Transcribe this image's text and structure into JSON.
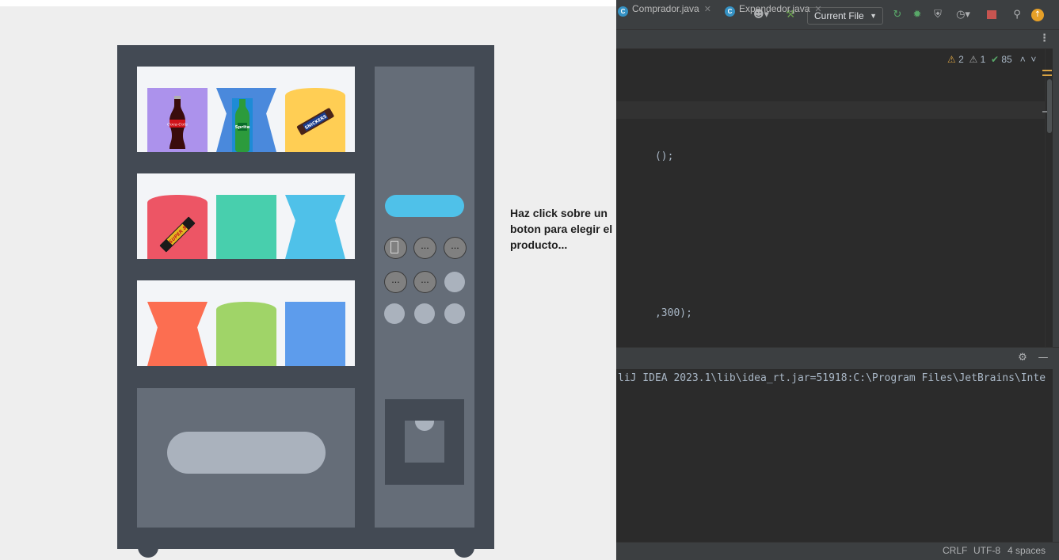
{
  "app": {
    "instruction": "Haz click sobre un boton para elegir el producto...",
    "button_label": "...",
    "products": {
      "coca_cola": "Coca-Cola",
      "sprite": "Sprite",
      "snickers": "SNICKERS",
      "super8": "SUPER 8"
    },
    "colors": {
      "machine_frame": "#434a54",
      "panel": "#656d78",
      "display": "#4fc1e9",
      "shelf_bg": "#f3f5f8",
      "purple": "#ac92ec",
      "blue_cup": "#4a89dc",
      "yellow": "#ffce54",
      "red": "#ed5565",
      "mint": "#48cfad",
      "cyan": "#4fc1e9",
      "orange": "#fc6e51",
      "green": "#a0d468",
      "blue": "#5d9cec"
    }
  },
  "ide": {
    "run_config": "Current File",
    "tabs": [
      {
        "label": "Comprador.java",
        "icon": "java-class-icon"
      },
      {
        "label": "Expendedor.java",
        "icon": "java-class-icon"
      }
    ],
    "inspections": {
      "warnings": "2",
      "weak_warnings": "1",
      "ok": "85"
    },
    "code_fragments": [
      "();",
      ",300);"
    ],
    "run_output": "liJ IDEA 2023.1\\lib\\idea_rt.jar=51918:C:\\Program Files\\JetBrains\\Inte",
    "status": {
      "line_sep": "CRLF",
      "encoding": "UTF-8",
      "indent": "4 spaces"
    }
  }
}
